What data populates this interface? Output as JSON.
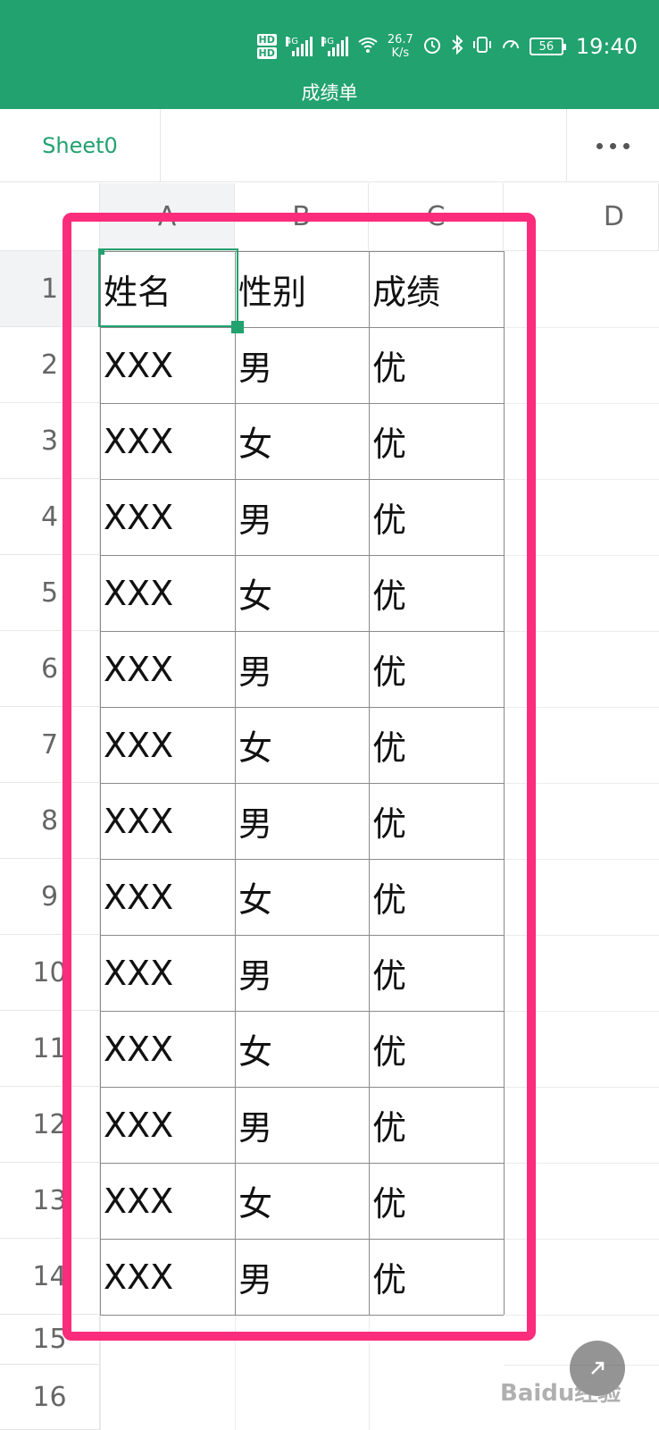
{
  "status_bar": {
    "hd1": "HD",
    "hd2": "HD",
    "net1": "4G",
    "net2": "4G",
    "speed_value": "26.7",
    "speed_unit": "K/s",
    "battery": "56",
    "time": "19:40"
  },
  "doc_title": "成绩单",
  "sheet_tab": "Sheet0",
  "columns": [
    "A",
    "B",
    "C",
    "D"
  ],
  "rows": [
    "1",
    "2",
    "3",
    "4",
    "5",
    "6",
    "7",
    "8",
    "9",
    "10",
    "11",
    "12",
    "13",
    "14",
    "15",
    "16"
  ],
  "table": {
    "headers": [
      "姓名",
      "性别",
      "成绩"
    ],
    "rows": [
      [
        "XXX",
        "男",
        "优"
      ],
      [
        "XXX",
        "女",
        "优"
      ],
      [
        "XXX",
        "男",
        "优"
      ],
      [
        "XXX",
        "女",
        "优"
      ],
      [
        "XXX",
        "男",
        "优"
      ],
      [
        "XXX",
        "女",
        "优"
      ],
      [
        "XXX",
        "男",
        "优"
      ],
      [
        "XXX",
        "女",
        "优"
      ],
      [
        "XXX",
        "男",
        "优"
      ],
      [
        "XXX",
        "女",
        "优"
      ],
      [
        "XXX",
        "男",
        "优"
      ],
      [
        "XXX",
        "女",
        "优"
      ],
      [
        "XXX",
        "男",
        "优"
      ]
    ]
  },
  "watermark": "Baidu经验",
  "colors": {
    "brand": "#22a26f",
    "highlight": "#fb2c7c"
  }
}
